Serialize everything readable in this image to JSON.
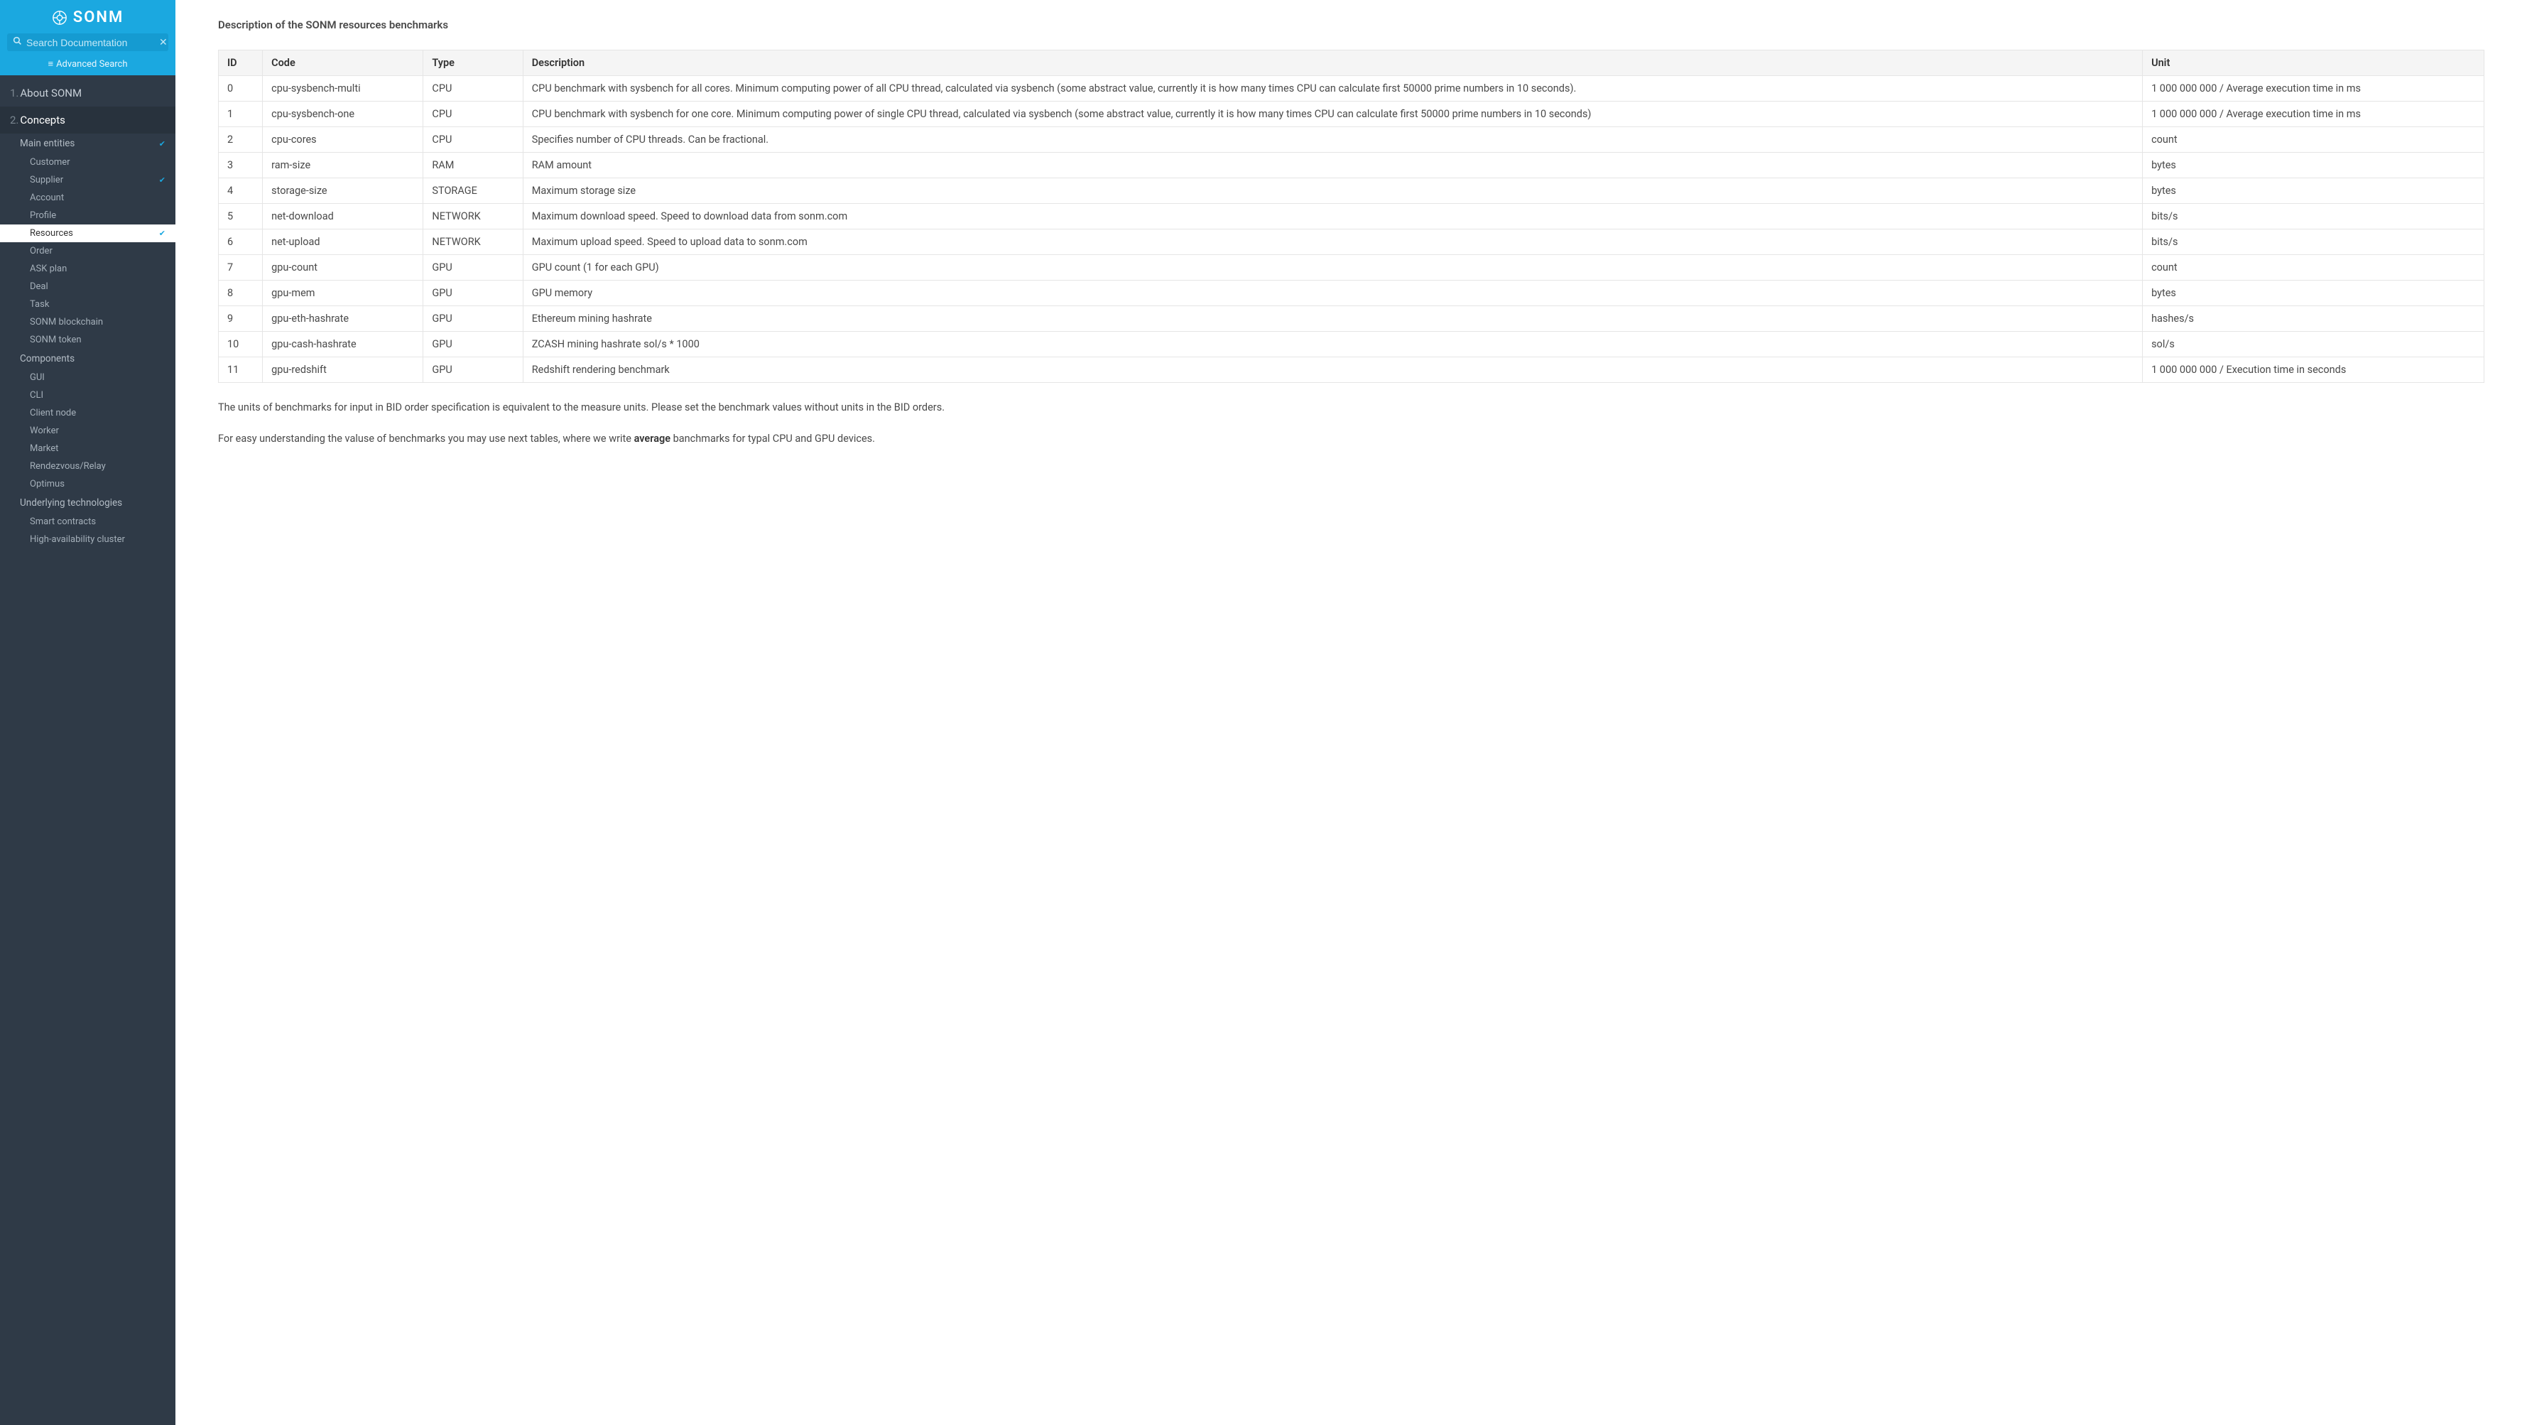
{
  "brand": "SONM",
  "search": {
    "placeholder": "Search Documentation",
    "advanced": "Advanced Search"
  },
  "nav": {
    "sections": [
      {
        "num": "1.",
        "label": "About SONM"
      },
      {
        "num": "2.",
        "label": "Concepts"
      }
    ],
    "main_entities": "Main entities",
    "items_entities": [
      "Customer",
      "Supplier",
      "Account",
      "Profile",
      "Resources",
      "Order",
      "ASK plan",
      "Deal",
      "Task",
      "SONM blockchain",
      "SONM token"
    ],
    "components": "Components",
    "items_components": [
      "GUI",
      "CLI",
      "Client node",
      "Worker",
      "Market",
      "Rendezvous/Relay",
      "Optimus"
    ],
    "underlying": "Underlying technologies",
    "items_underlying": [
      "Smart contracts",
      "High-availability cluster"
    ]
  },
  "main": {
    "title": "Description of the SONM resources benchmarks",
    "headers": {
      "id": "ID",
      "code": "Code",
      "type": "Type",
      "desc": "Description",
      "unit": "Unit"
    },
    "rows": [
      {
        "id": "0",
        "code": "cpu-sysbench-multi",
        "type": "CPU",
        "desc": "CPU benchmark with sysbench for all cores. Minimum computing power of all CPU thread, calculated via sysbench (some abstract value, currently it is how many times CPU can calculate first 50000 prime numbers in 10 seconds).",
        "unit": "1 000 000 000 / Average execution time in ms"
      },
      {
        "id": "1",
        "code": "cpu-sysbench-one",
        "type": "CPU",
        "desc": "CPU benchmark with sysbench for one core. Minimum computing power of single CPU thread, calculated via sysbench (some abstract value, currently it is how many times CPU can calculate first 50000 prime numbers in 10 seconds)",
        "unit": "1 000 000 000 / Average execution time in ms"
      },
      {
        "id": "2",
        "code": "cpu-cores",
        "type": "CPU",
        "desc": "Specifies number of CPU threads. Can be fractional.",
        "unit": "count"
      },
      {
        "id": "3",
        "code": "ram-size",
        "type": "RAM",
        "desc": "RAM amount",
        "unit": "bytes"
      },
      {
        "id": "4",
        "code": "storage-size",
        "type": "STORAGE",
        "desc": "Maximum storage size",
        "unit": "bytes"
      },
      {
        "id": "5",
        "code": "net-download",
        "type": "NETWORK",
        "desc": "Maximum download speed. Speed to download data from sonm.com",
        "unit": "bits/s"
      },
      {
        "id": "6",
        "code": "net-upload",
        "type": "NETWORK",
        "desc": "Maximum upload speed. Speed to upload data to sonm.com",
        "unit": "bits/s"
      },
      {
        "id": "7",
        "code": "gpu-count",
        "type": "GPU",
        "desc": "GPU count (1 for each GPU)",
        "unit": "count"
      },
      {
        "id": "8",
        "code": "gpu-mem",
        "type": "GPU",
        "desc": "GPU memory",
        "unit": "bytes"
      },
      {
        "id": "9",
        "code": "gpu-eth-hashrate",
        "type": "GPU",
        "desc": "Ethereum mining hashrate",
        "unit": "hashes/s"
      },
      {
        "id": "10",
        "code": "gpu-cash-hashrate",
        "type": "GPU",
        "desc": "ZCASH mining hashrate sol/s * 1000",
        "unit": "sol/s"
      },
      {
        "id": "11",
        "code": "gpu-redshift",
        "type": "GPU",
        "desc": "Redshift rendering benchmark",
        "unit": "1 000 000 000 / Execution time in seconds"
      }
    ],
    "p1": "The units of benchmarks for input in BID order specification is equivalent to the measure units. Please set the benchmark values without units in the BID orders.",
    "p2a": "For easy understanding the valuse of benchmarks you may use next tables, where we write ",
    "p2b": "average",
    "p2c": " banchmarks for typal CPU and GPU devices."
  }
}
